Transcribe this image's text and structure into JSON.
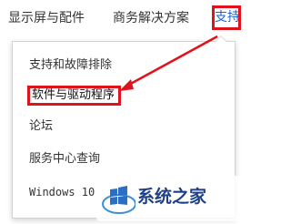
{
  "top_nav": {
    "items": [
      {
        "label": "显示屏与配件"
      },
      {
        "label": "商务解决方案"
      },
      {
        "label": "支持"
      }
    ]
  },
  "dropdown": {
    "items": [
      {
        "label": "支持和故障排除"
      },
      {
        "label": "软件与驱动程序"
      },
      {
        "label": "论坛"
      },
      {
        "label": "服务中心查询"
      },
      {
        "label": "Windows 10"
      }
    ]
  },
  "annotation": {
    "highlight_color": "#e0121b"
  },
  "watermark": {
    "text": "系统之家"
  }
}
